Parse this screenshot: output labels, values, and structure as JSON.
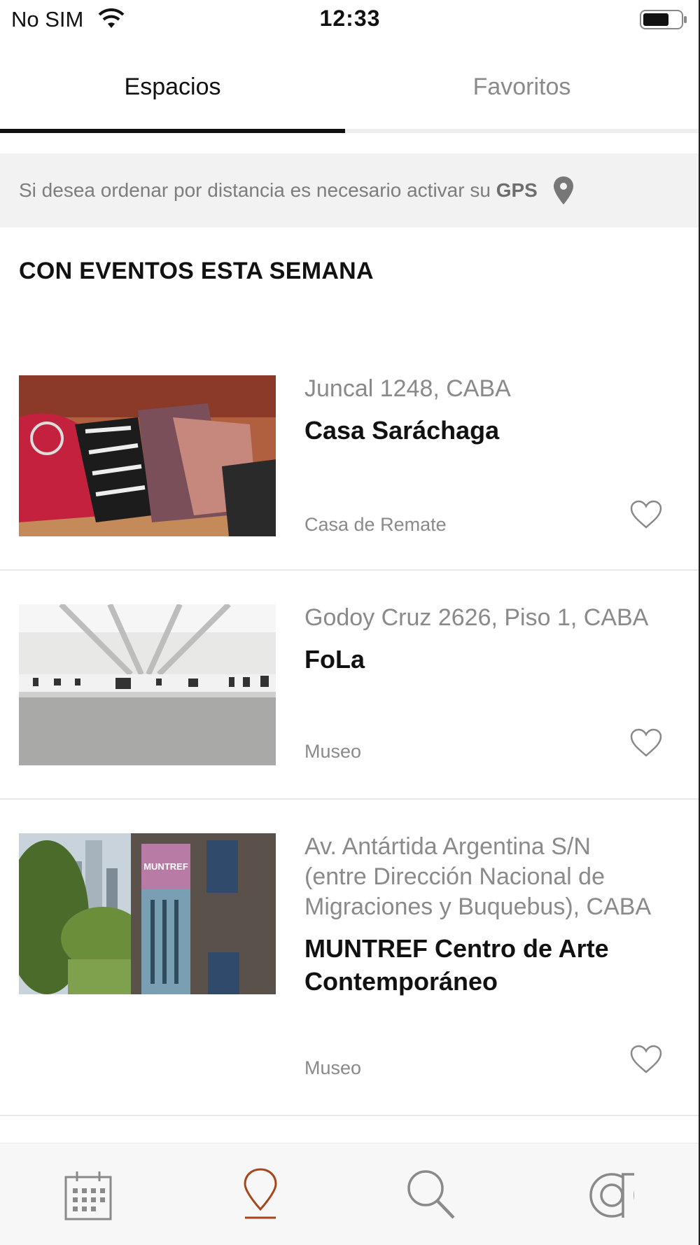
{
  "status_bar": {
    "carrier": "No SIM",
    "time": "12:33"
  },
  "tabs": [
    {
      "label": "Espacios",
      "active": true
    },
    {
      "label": "Favoritos",
      "active": false
    }
  ],
  "gps_banner": {
    "text": "Si desea ordenar por distancia es necesario activar su ",
    "bold": "GPS"
  },
  "section_title": "CON EVENTOS ESTA SEMANA",
  "venues": [
    {
      "address": "Juncal 1248, CABA",
      "name": "Casa Saráchaga",
      "category": "Casa de Remate"
    },
    {
      "address": "Godoy Cruz 2626, Piso 1, CABA",
      "name": "FoLa",
      "category": "Museo"
    },
    {
      "address": "Av. Antártida Argentina S/N (entre Dirección Nacional de Migraciones y Buquebus), CABA",
      "name": "MUNTREF Centro de Arte Contemporáneo",
      "category": "Museo",
      "image_banner": "MUNTREF"
    }
  ],
  "bottom_nav": [
    {
      "icon": "calendar-icon",
      "active": false
    },
    {
      "icon": "map-pin-icon",
      "active": true
    },
    {
      "icon": "search-icon",
      "active": false
    },
    {
      "icon": "at-sign-icon",
      "active": false
    }
  ],
  "colors": {
    "accent": "#a8461b",
    "muted": "#8a8a8a",
    "banner_bg": "#f2f2f2"
  }
}
